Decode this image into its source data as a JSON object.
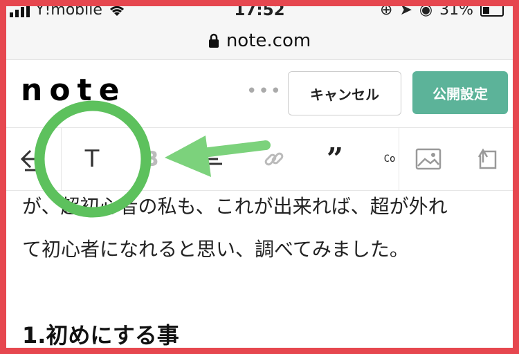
{
  "status_bar": {
    "carrier": "Y!mobile",
    "time": "17:52",
    "battery": "31%",
    "battery_level": 0.31
  },
  "address_bar": {
    "url": "note.com",
    "icon": "lock-icon"
  },
  "header": {
    "logo": "note",
    "more_label": "•••",
    "cancel_label": "キャンセル",
    "publish_label": "公開設定",
    "publish_color": "#5cb399"
  },
  "toolbar": {
    "text_style": "T",
    "bold": "B",
    "quote": "”",
    "code": "Co",
    "icons": [
      "back-icon",
      "text-style-icon",
      "bold-icon",
      "align-icon",
      "link-icon",
      "quote-icon",
      "code-icon",
      "image-icon",
      "embed-icon"
    ]
  },
  "editor": {
    "line1": "が、超初心者の私も、これが出来れば、超が外れ",
    "line2": "て初心者になれると思い、調べてみました。",
    "heading": "1.初めにする事"
  },
  "annotation": {
    "circle_color": "#5dc15d",
    "arrow_color": "#7cd27c",
    "frame_color": "#e6474f"
  }
}
